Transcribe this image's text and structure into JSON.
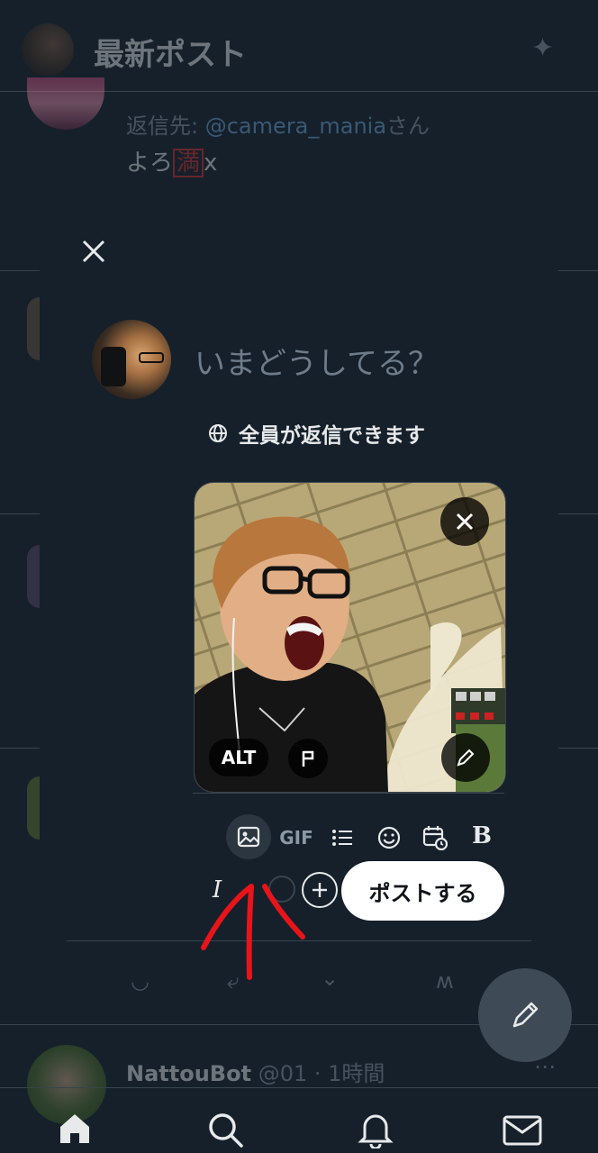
{
  "header": {
    "title": "最新ポスト",
    "sparkle_icon": "sparkle-icon"
  },
  "background_tweet": {
    "reply_label": "返信先:",
    "reply_handle": "@camera_mania",
    "reply_suffix": "さん",
    "text_before": "よろ",
    "text_boxed": "満",
    "text_after": "x"
  },
  "bottom_tweet": {
    "name": "NattouBot",
    "handle": "@01",
    "time": "· 1時間"
  },
  "composer": {
    "close_icon": "close-icon",
    "placeholder": "いまどうしてる？",
    "reply_setting": "全員が返信できます",
    "media": {
      "alt_label": "ALT",
      "flag_icon": "flag-icon",
      "edit_icon": "pencil-icon",
      "remove_icon": "close-icon"
    },
    "toolbar": {
      "image_icon": "image-icon",
      "gif_label": "GIF",
      "poll_icon": "list-icon",
      "emoji_icon": "emoji-icon",
      "schedule_icon": "calendar-clock-icon",
      "bold_label": "B",
      "italic_label": "I"
    },
    "post_button": "ポストする"
  },
  "colors": {
    "background": "#15202b",
    "accent_red": "#e8141a",
    "post_button_bg": "#ffffff"
  }
}
